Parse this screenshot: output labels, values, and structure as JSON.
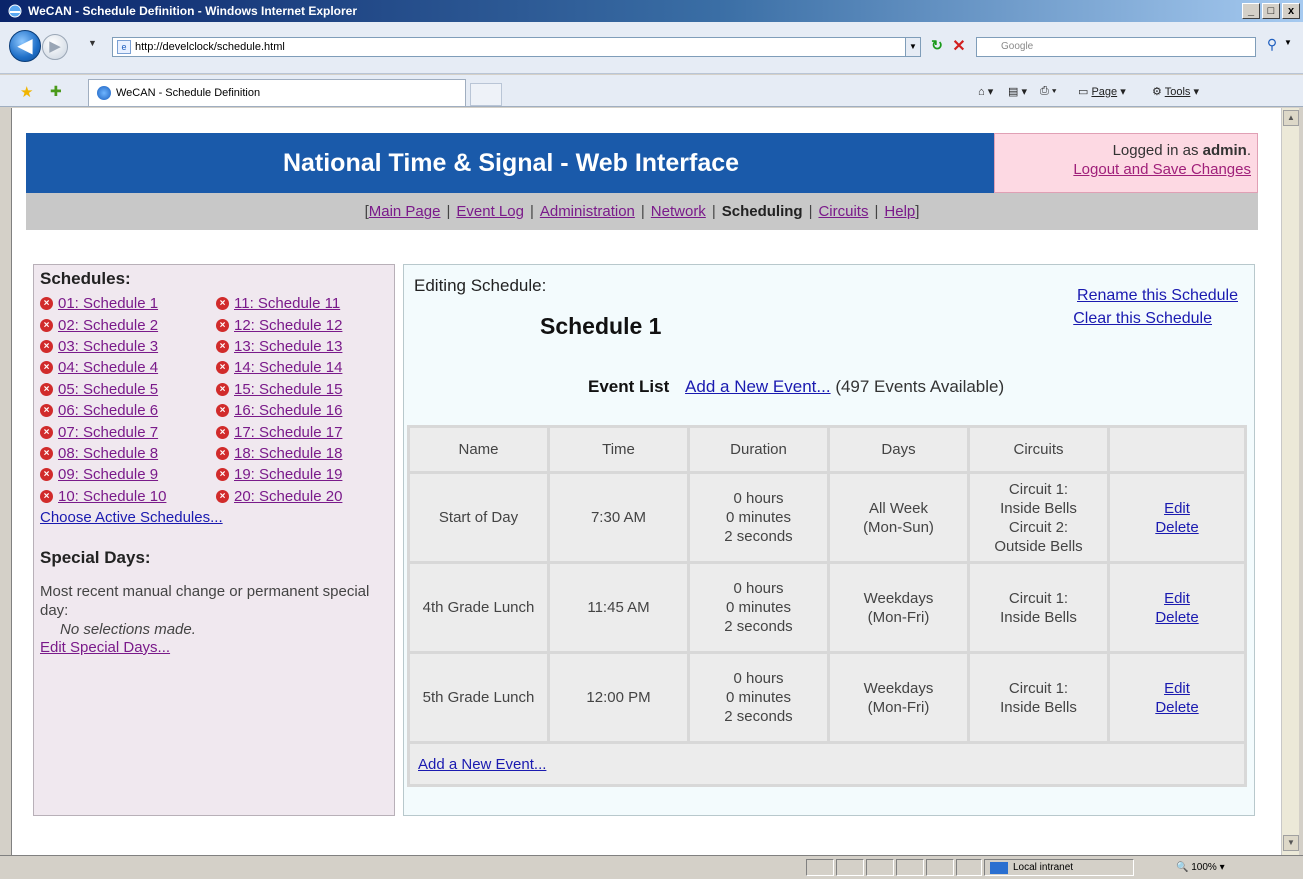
{
  "browser": {
    "window_title": "WeCAN - Schedule Definition - Windows Internet Explorer",
    "window_buttons": [
      "_",
      "□",
      "x"
    ],
    "address": "http://develclock/schedule.html",
    "search_placeholder": "Google",
    "tab_title": "WeCAN - Schedule Definition",
    "commands": {
      "page": "Page",
      "tools": "Tools"
    },
    "status": {
      "zone": "Local intranet",
      "zoom": "100%"
    }
  },
  "header": {
    "site_title": "National Time & Signal - Web Interface",
    "logged_in_prefix": "Logged in as ",
    "username": "admin",
    "logged_in_suffix": ".",
    "logout_link": "Logout and Save Changes"
  },
  "menu": {
    "open_bracket": "[",
    "close_bracket": "]",
    "separator": "|",
    "items": [
      {
        "label": "Main Page",
        "current": false
      },
      {
        "label": "Event Log",
        "current": false
      },
      {
        "label": "Administration",
        "current": false
      },
      {
        "label": "Network",
        "current": false
      },
      {
        "label": "Scheduling",
        "current": true
      },
      {
        "label": "Circuits",
        "current": false
      },
      {
        "label": "Help",
        "current": false
      }
    ]
  },
  "sidebar": {
    "schedules_title": "Schedules:",
    "schedules": [
      "01: Schedule 1",
      "11: Schedule 11",
      "02: Schedule 2",
      "12: Schedule 12",
      "03: Schedule 3",
      "13: Schedule 13",
      "04: Schedule 4",
      "14: Schedule 14",
      "05: Schedule 5",
      "15: Schedule 15",
      "06: Schedule 6",
      "16: Schedule 16",
      "07: Schedule 7",
      "17: Schedule 17",
      "08: Schedule 8",
      "18: Schedule 18",
      "09: Schedule 9",
      "19: Schedule 19",
      "10: Schedule 10",
      "20: Schedule 20"
    ],
    "choose_active": "Choose Active Schedules...",
    "special_days_title": "Special Days:",
    "special_desc": "Most recent manual change or permanent special day:",
    "special_none": "No selections made.",
    "edit_special": "Edit Special Days..."
  },
  "main": {
    "editing_label": "Editing Schedule:",
    "schedule_name": "Schedule 1",
    "rename_link": "Rename this Schedule",
    "clear_link": "Clear this Schedule",
    "event_list_title": "Event List",
    "add_event_link": "Add a New Event...",
    "events_available": "(497 Events Available)",
    "columns": [
      "Name",
      "Time",
      "Duration",
      "Days",
      "Circuits",
      ""
    ],
    "events": [
      {
        "name": "Start of Day",
        "time": "7:30 AM",
        "duration": [
          "0 hours",
          "0 minutes",
          "2 seconds"
        ],
        "days": [
          "All Week",
          "(Mon-Sun)"
        ],
        "circuits": [
          "Circuit 1:",
          "Inside Bells",
          "Circuit 2:",
          "Outside Bells"
        ]
      },
      {
        "name": "4th Grade Lunch",
        "time": "11:45 AM",
        "duration": [
          "0 hours",
          "0 minutes",
          "2 seconds"
        ],
        "days": [
          "Weekdays",
          "(Mon-Fri)"
        ],
        "circuits": [
          "Circuit 1:",
          "Inside Bells"
        ]
      },
      {
        "name": "5th Grade Lunch",
        "time": "12:00 PM",
        "duration": [
          "0 hours",
          "0 minutes",
          "2 seconds"
        ],
        "days": [
          "Weekdays",
          "(Mon-Fri)"
        ],
        "circuits": [
          "Circuit 1:",
          "Inside Bells"
        ]
      }
    ],
    "edit_label": "Edit",
    "delete_label": "Delete",
    "footer_add_link": "Add a New Event..."
  }
}
